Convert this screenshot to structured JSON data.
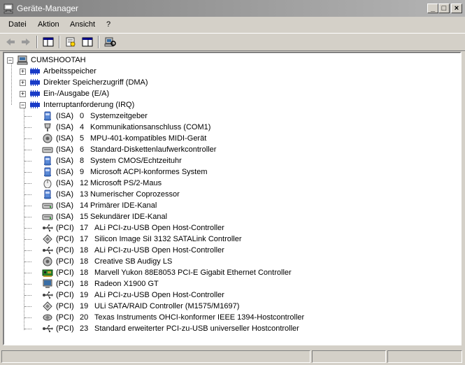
{
  "window": {
    "title": "Geräte-Manager"
  },
  "menu": [
    "Datei",
    "Aktion",
    "Ansicht",
    "?"
  ],
  "tree": {
    "root": "CUMSHOOTAH",
    "categories": [
      "Arbeitsspeicher",
      "Direkter Speicherzugriff (DMA)",
      "Ein-/Ausgabe (E/A)",
      "Interruptanforderung (IRQ)"
    ],
    "devices": [
      {
        "bus": "(ISA)",
        "irq": "0",
        "name": "Systemzeitgeber",
        "icon": "system-icon"
      },
      {
        "bus": "(ISA)",
        "irq": "4",
        "name": "Kommunikationsanschluss (COM1)",
        "icon": "port-icon"
      },
      {
        "bus": "(ISA)",
        "irq": "5",
        "name": "MPU-401-kompatibles MIDI-Gerät",
        "icon": "sound-icon"
      },
      {
        "bus": "(ISA)",
        "irq": "6",
        "name": "Standard-Diskettenlaufwerkcontroller",
        "icon": "floppy-controller-icon"
      },
      {
        "bus": "(ISA)",
        "irq": "8",
        "name": "System CMOS/Echtzeituhr",
        "icon": "system-icon"
      },
      {
        "bus": "(ISA)",
        "irq": "9",
        "name": "Microsoft ACPI-konformes System",
        "icon": "system-icon"
      },
      {
        "bus": "(ISA)",
        "irq": "12",
        "name": "Microsoft PS/2-Maus",
        "icon": "mouse-icon"
      },
      {
        "bus": "(ISA)",
        "irq": "13",
        "name": "Numerischer Coprozessor",
        "icon": "system-icon"
      },
      {
        "bus": "(ISA)",
        "irq": "14",
        "name": "Primärer IDE-Kanal",
        "icon": "ide-icon"
      },
      {
        "bus": "(ISA)",
        "irq": "15",
        "name": "Sekundärer IDE-Kanal",
        "icon": "ide-icon"
      },
      {
        "bus": "(PCI)",
        "irq": "17",
        "name": "ALi PCI-zu-USB Open Host-Controller",
        "icon": "usb-icon"
      },
      {
        "bus": "(PCI)",
        "irq": "17",
        "name": "Silicon Image SiI 3132 SATALink Controller",
        "icon": "scsi-icon"
      },
      {
        "bus": "(PCI)",
        "irq": "18",
        "name": "ALi PCI-zu-USB Open Host-Controller",
        "icon": "usb-icon"
      },
      {
        "bus": "(PCI)",
        "irq": "18",
        "name": "Creative SB Audigy LS",
        "icon": "sound-icon"
      },
      {
        "bus": "(PCI)",
        "irq": "18",
        "name": "Marvell Yukon 88E8053 PCI-E Gigabit Ethernet Controller",
        "icon": "network-icon"
      },
      {
        "bus": "(PCI)",
        "irq": "18",
        "name": "Radeon X1900 GT",
        "icon": "display-icon"
      },
      {
        "bus": "(PCI)",
        "irq": "19",
        "name": "ALi PCI-zu-USB Open Host-Controller",
        "icon": "usb-icon"
      },
      {
        "bus": "(PCI)",
        "irq": "19",
        "name": "ULi SATA/RAID Controller (M1575/M1697)",
        "icon": "scsi-icon"
      },
      {
        "bus": "(PCI)",
        "irq": "20",
        "name": "Texas Instruments OHCI-konformer IEEE 1394-Hostcontroller",
        "icon": "firewire-icon"
      },
      {
        "bus": "(PCI)",
        "irq": "23",
        "name": "Standard erweiterter PCI-zu-USB universeller Hostcontroller",
        "icon": "usb-icon"
      }
    ]
  },
  "glyphs": {
    "minimize": "_",
    "maximize": "□",
    "close": "×",
    "plus": "+",
    "minus": "−"
  }
}
